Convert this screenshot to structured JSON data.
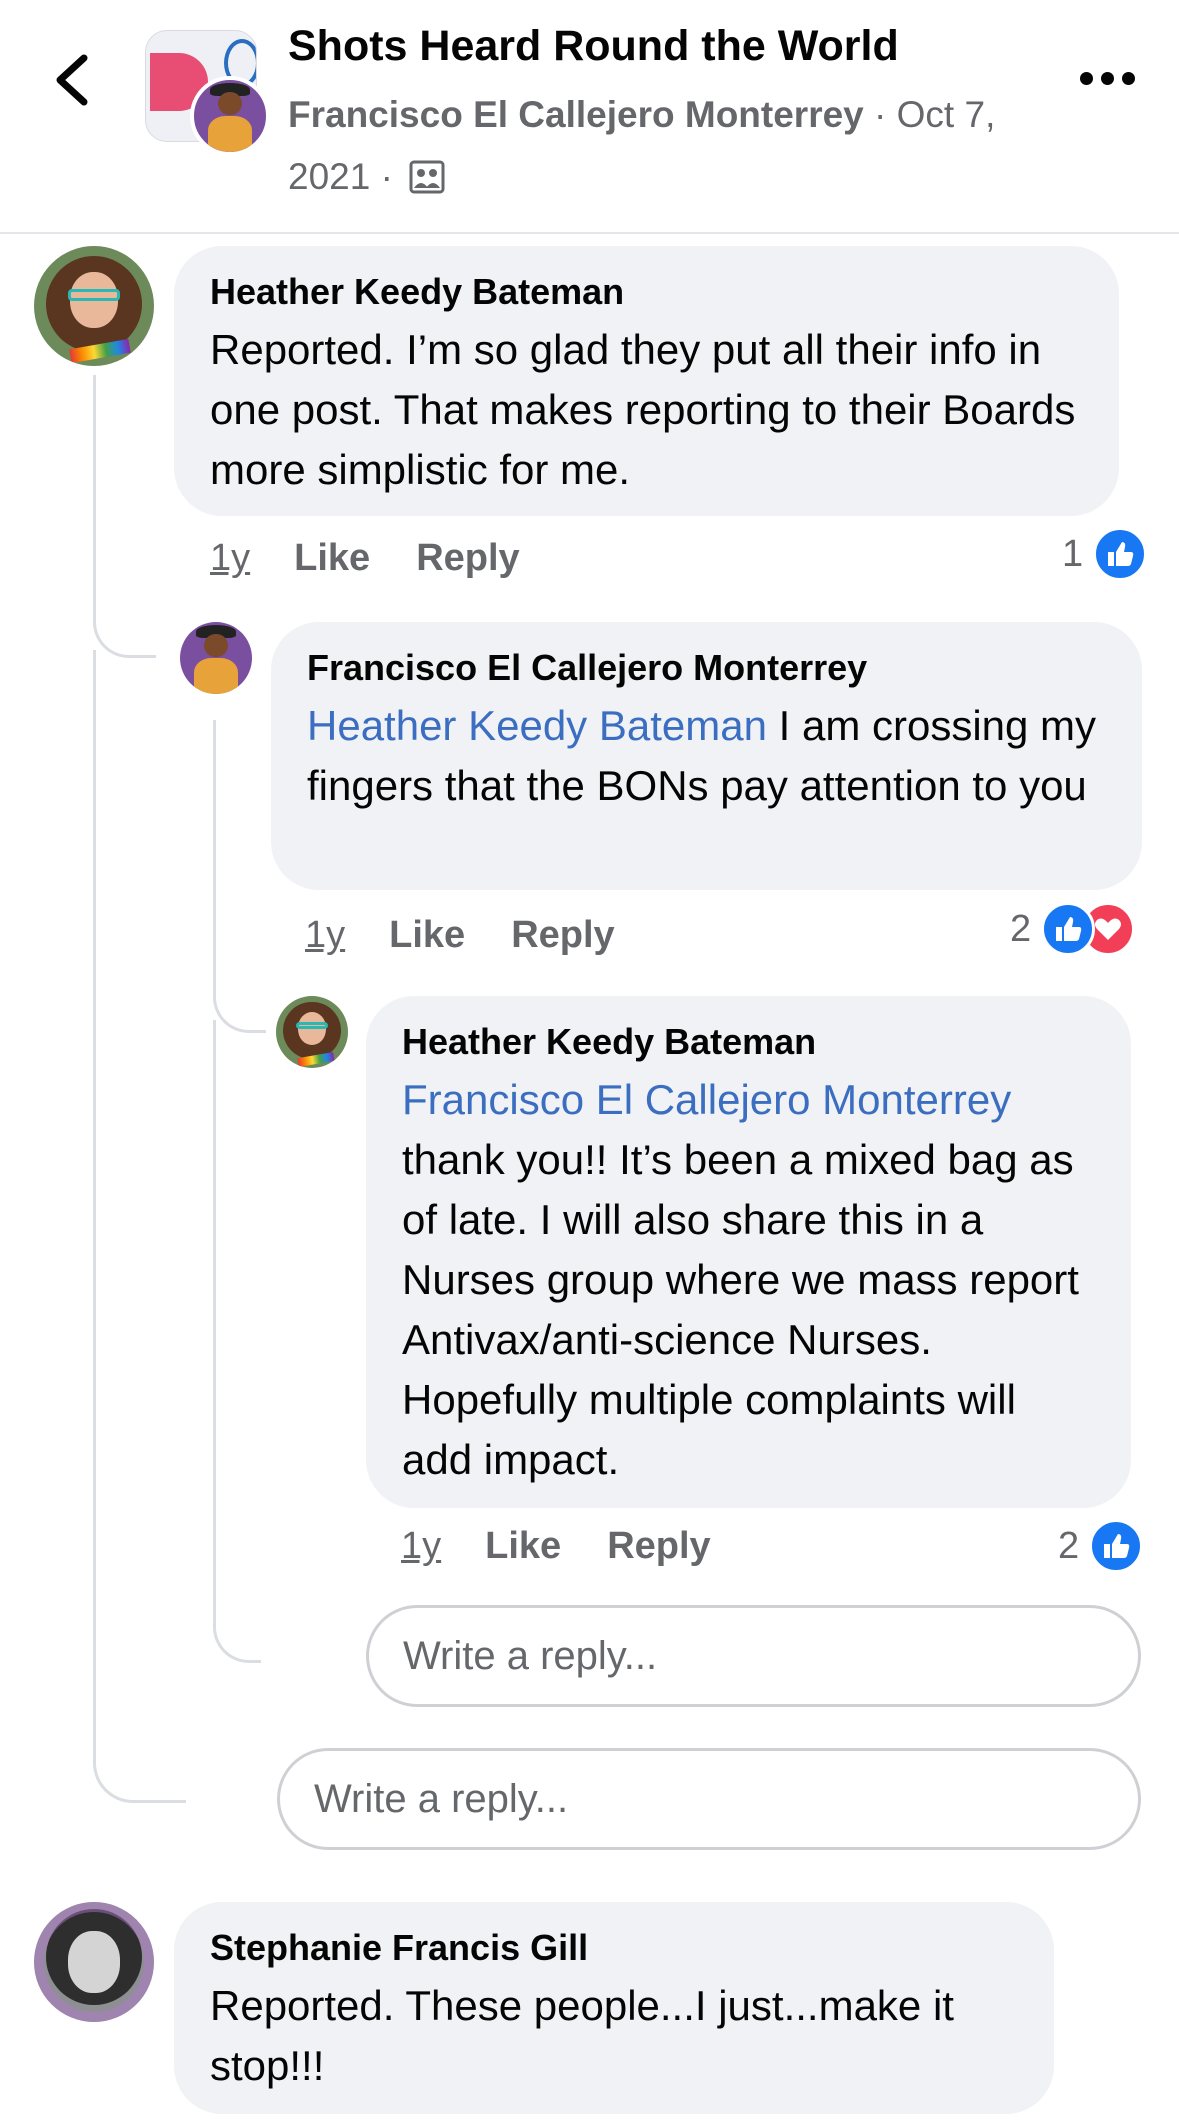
{
  "header": {
    "group_name": "Shots Heard Round the World",
    "poster": "Francisco El Callejero Monterrey",
    "separator": " · ",
    "date": "Oct 7, 2021",
    "separator2": " · "
  },
  "comments": [
    {
      "author": "Heather Keedy Bateman",
      "text": "Reported. I’m so glad they put all their info in one post. That makes reporting to their Boards more simplistic for me.",
      "time": "1y",
      "like_label": "Like",
      "reply_label": "Reply",
      "reaction_count": "1",
      "replies": [
        {
          "author": "Francisco El Callejero Monterrey",
          "mention": "Heather Keedy Bateman",
          "text": " I am crossing my fingers that the BONs pay attention to you",
          "time": "1y",
          "like_label": "Like",
          "reply_label": "Reply",
          "reaction_count": "2",
          "replies": [
            {
              "author": "Heather Keedy Bateman",
              "mention": "Francisco El Callejero Monterrey",
              "text": "thank you!! It’s been a mixed bag as of late. I will also share this in a Nurses group where we mass report Antivax/anti-science Nurses.  Hopefully multiple complaints will add impact.",
              "time": "1y",
              "like_label": "Like",
              "reply_label": "Reply",
              "reaction_count": "2"
            }
          ],
          "reply_placeholder": "Write a reply..."
        }
      ],
      "reply_placeholder": "Write a reply..."
    },
    {
      "author": "Stephanie Francis Gill",
      "text": "Reported. These people...I just...make it stop!!!"
    }
  ],
  "icons": {
    "back": "chevron-left-icon",
    "more": "more-horizontal-icon",
    "audience": "group-audience-icon",
    "like": "like-reaction-icon",
    "love": "love-reaction-icon"
  },
  "colors": {
    "like_blue": "#1877f2",
    "love_red": "#f33e58",
    "mention_blue": "#3b6ec0",
    "bubble_bg": "#f0f2f5",
    "secondary_text": "#65676b"
  }
}
